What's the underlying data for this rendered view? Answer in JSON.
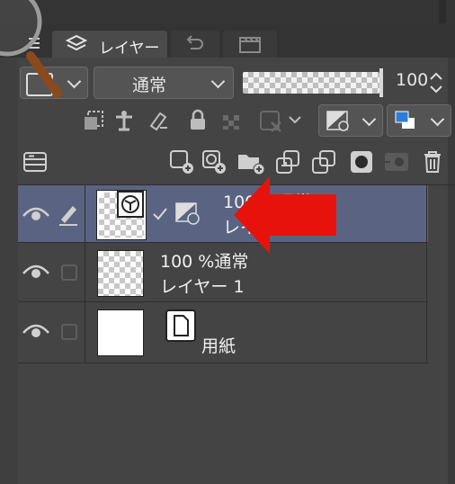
{
  "tabs": [
    {
      "label": "レイヤー",
      "icon": "layers-icon",
      "active": true
    },
    {
      "label": "",
      "icon": "undo-history-icon",
      "active": false
    },
    {
      "label": "",
      "icon": "clapperboard-icon",
      "active": false
    }
  ],
  "toolbar": {
    "blend_mode": "通常",
    "opacity_value": "100"
  },
  "layers": [
    {
      "opacity_mode": "100 %通常",
      "name": "レイヤー 2",
      "selected": true,
      "visible": true
    },
    {
      "opacity_mode": "100 %通常",
      "name": "レイヤー 1",
      "selected": false,
      "visible": true
    },
    {
      "name": "用紙",
      "selected": false,
      "visible": true
    }
  ],
  "overlay": {
    "arrow_color": "#e8120c"
  },
  "colors": {
    "selected_row": "#5a6482",
    "panel_bg": "#444444"
  }
}
